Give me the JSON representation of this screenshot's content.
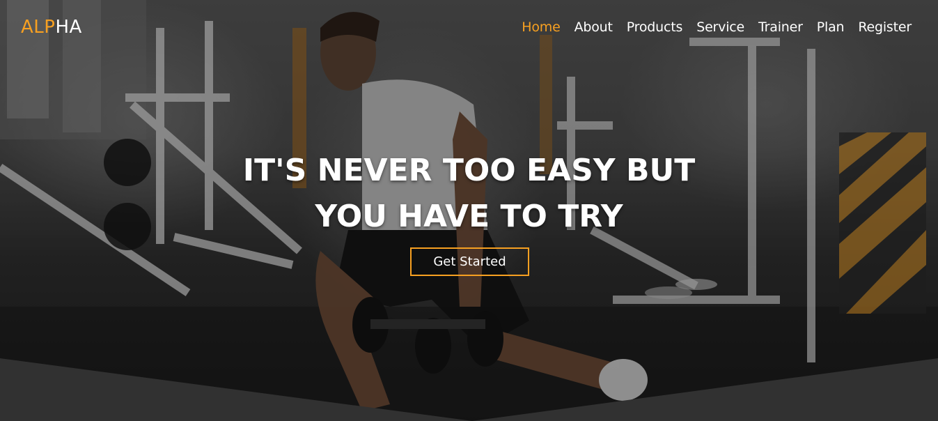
{
  "brand": {
    "logo_accent": "ALP",
    "logo_rest": "HA",
    "accent_color": "#f7a021"
  },
  "nav": {
    "items": [
      {
        "label": "Home",
        "active": true
      },
      {
        "label": "About",
        "active": false
      },
      {
        "label": "Products",
        "active": false
      },
      {
        "label": "Service",
        "active": false
      },
      {
        "label": "Trainer",
        "active": false
      },
      {
        "label": "Plan",
        "active": false
      },
      {
        "label": "Register",
        "active": false
      }
    ]
  },
  "hero": {
    "headline_line1": "IT'S NEVER TOO EASY BUT",
    "headline_line2": "YOU HAVE TO TRY",
    "cta_label": "Get Started",
    "background_image": "gym-lunge-dumbbells-photo"
  }
}
